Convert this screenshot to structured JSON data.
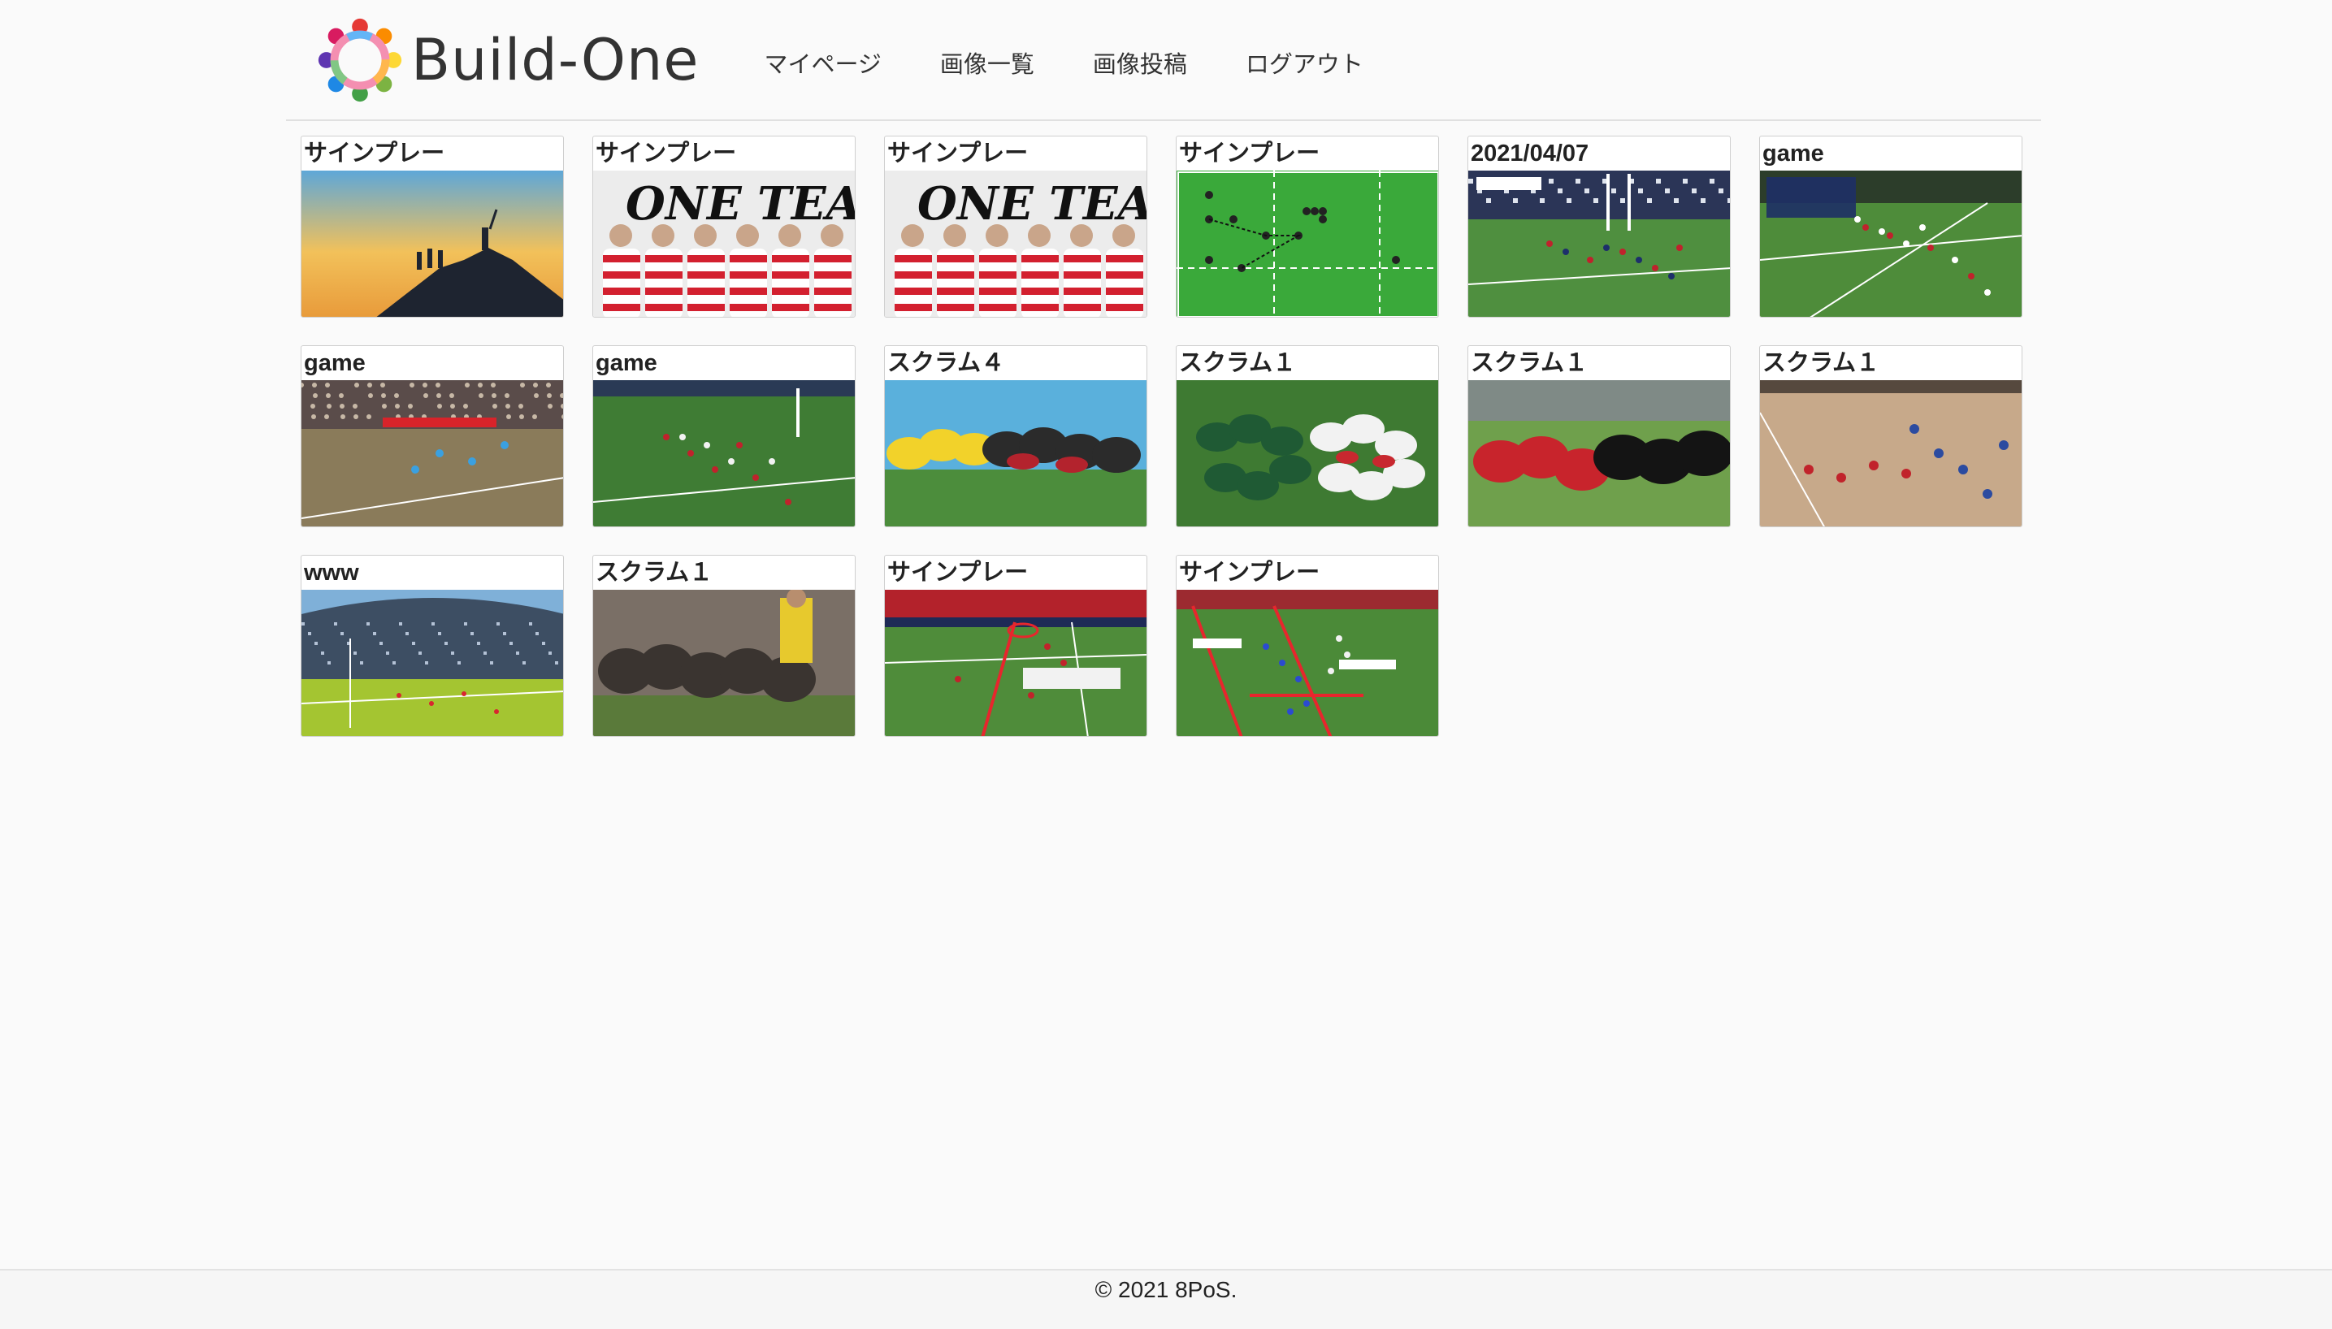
{
  "header": {
    "logo_text": "Build-One",
    "nav": [
      "マイページ",
      "画像一覧",
      "画像投稿",
      "ログアウト"
    ]
  },
  "posts": [
    {
      "title": "サインプレー",
      "image": "sunset-summit"
    },
    {
      "title": "サインプレー",
      "image": "one-team-poster"
    },
    {
      "title": "サインプレー",
      "image": "one-team-poster"
    },
    {
      "title": "サインプレー",
      "image": "set-play-diagram"
    },
    {
      "title": "2021/04/07",
      "image": "stadium-broadcast"
    },
    {
      "title": "game",
      "image": "pitch-broadcast-overlay"
    },
    {
      "title": "game",
      "image": "crowd-backline"
    },
    {
      "title": "game",
      "image": "pitch-broadcast"
    },
    {
      "title": "スクラム４",
      "image": "scrum-blue-stands"
    },
    {
      "title": "スクラム１",
      "image": "scrum-top-view"
    },
    {
      "title": "スクラム１",
      "image": "scrum-close"
    },
    {
      "title": "スクラム１",
      "image": "dirt-field-play"
    },
    {
      "title": "www",
      "image": "wide-stadium"
    },
    {
      "title": "スクラム１",
      "image": "muddy-scrum"
    },
    {
      "title": "サインプレー",
      "image": "offside-line-annotated"
    },
    {
      "title": "サインプレー",
      "image": "penalty-line-annotated"
    }
  ],
  "footer": {
    "copyright": "© 2021 8PoS."
  }
}
